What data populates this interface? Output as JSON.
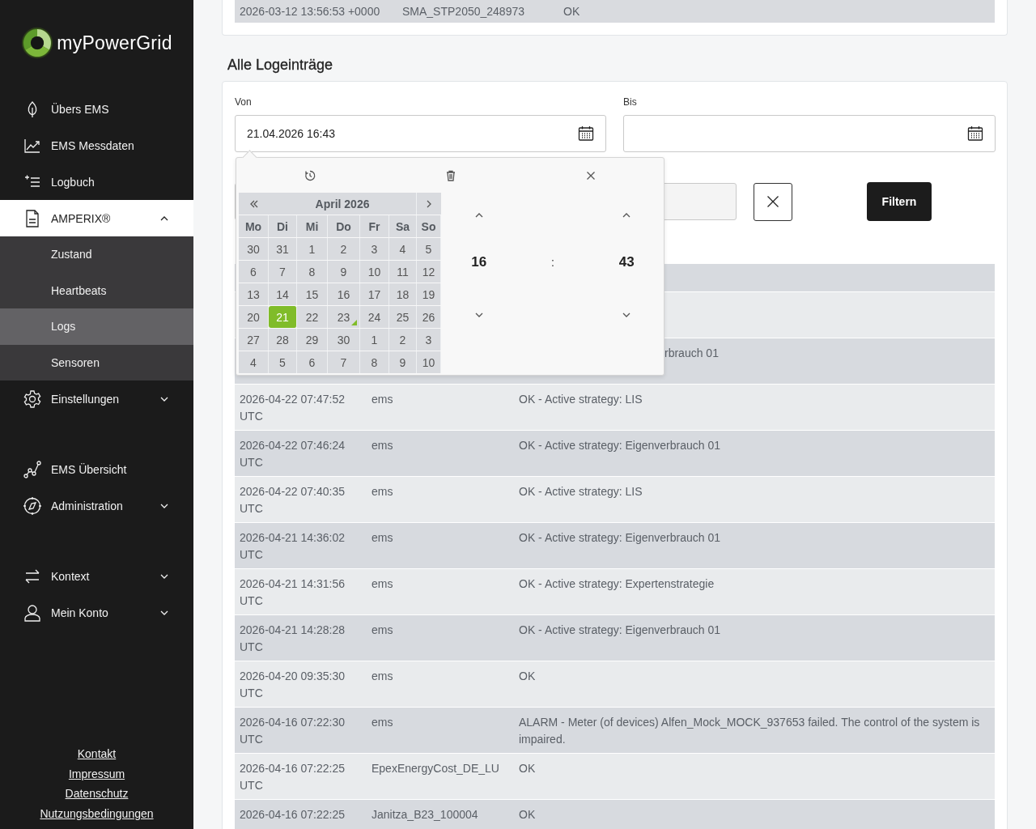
{
  "sidebar": {
    "logo": "myPowerGrid",
    "groups": [
      {
        "items": [
          {
            "label": "Übers EMS",
            "selected": false
          },
          {
            "label": "EMS Messdaten",
            "selected": false
          },
          {
            "label": "Logbuch",
            "selected": false
          },
          {
            "label": "AMPERIX®",
            "selected": false,
            "expanded": true,
            "children": [
              {
                "label": "Zustand",
                "selected": false
              },
              {
                "label": "Heartbeats",
                "selected": false
              },
              {
                "label": "Logs",
                "selected": true
              },
              {
                "label": "Sensoren",
                "selected": false
              }
            ]
          },
          {
            "label": "Einstellungen",
            "selected": false,
            "expanded": false
          }
        ]
      },
      {
        "items": [
          {
            "label": "EMS Übersicht",
            "selected": false
          },
          {
            "label": "Administration",
            "selected": false,
            "expanded": false
          }
        ]
      },
      {
        "items": [
          {
            "label": "Kontext",
            "selected": false,
            "expanded": false
          },
          {
            "label": "Mein Konto",
            "selected": false,
            "expanded": false
          }
        ]
      }
    ],
    "footer_links": [
      "Kontakt",
      "Impressum",
      "Datenschutz",
      "Nutzungsbedingungen"
    ]
  },
  "top_table": {
    "rows": [
      {
        "time": "2026-03-12 13:56:53 +0000",
        "source": "SMA_STP2050_248973",
        "message": "OK"
      }
    ]
  },
  "section_title": "Alle Logeinträge",
  "filter": {
    "from": {
      "label": "Von",
      "value": "21.04.2026 16:43"
    },
    "to": {
      "label": "Bis"
    },
    "filter_button": "Filtern"
  },
  "date_picker": {
    "month": "April 2026",
    "weekdays": [
      "Mo",
      "Di",
      "Mi",
      "Do",
      "Fr",
      "Sa",
      "So"
    ],
    "days": [
      {
        "d": "30",
        "selected": false,
        "today": false
      },
      {
        "d": "31",
        "selected": false,
        "today": false
      },
      {
        "d": "1",
        "selected": false,
        "today": false
      },
      {
        "d": "2",
        "selected": false,
        "today": false
      },
      {
        "d": "3",
        "selected": false,
        "today": false
      },
      {
        "d": "4",
        "selected": false,
        "today": false
      },
      {
        "d": "5",
        "selected": false,
        "today": false
      },
      {
        "d": "6",
        "selected": false,
        "today": false
      },
      {
        "d": "7",
        "selected": false,
        "today": false
      },
      {
        "d": "8",
        "selected": false,
        "today": false
      },
      {
        "d": "9",
        "selected": false,
        "today": false
      },
      {
        "d": "10",
        "selected": false,
        "today": false
      },
      {
        "d": "11",
        "selected": false,
        "today": false
      },
      {
        "d": "12",
        "selected": false,
        "today": false
      },
      {
        "d": "13",
        "selected": false,
        "today": false
      },
      {
        "d": "14",
        "selected": false,
        "today": false
      },
      {
        "d": "15",
        "selected": false,
        "today": false
      },
      {
        "d": "16",
        "selected": false,
        "today": false
      },
      {
        "d": "17",
        "selected": false,
        "today": false
      },
      {
        "d": "18",
        "selected": false,
        "today": false
      },
      {
        "d": "19",
        "selected": false,
        "today": false
      },
      {
        "d": "20",
        "selected": false,
        "today": false
      },
      {
        "d": "21",
        "selected": true,
        "today": false
      },
      {
        "d": "22",
        "selected": false,
        "today": false
      },
      {
        "d": "23",
        "selected": false,
        "today": true
      },
      {
        "d": "24",
        "selected": false,
        "today": false
      },
      {
        "d": "25",
        "selected": false,
        "today": false
      },
      {
        "d": "26",
        "selected": false,
        "today": false
      },
      {
        "d": "27",
        "selected": false,
        "today": false
      },
      {
        "d": "28",
        "selected": false,
        "today": false
      },
      {
        "d": "29",
        "selected": false,
        "today": false
      },
      {
        "d": "30",
        "selected": false,
        "today": false
      },
      {
        "d": "1",
        "selected": false,
        "today": false
      },
      {
        "d": "2",
        "selected": false,
        "today": false
      },
      {
        "d": "3",
        "selected": false,
        "today": false
      },
      {
        "d": "4",
        "selected": false,
        "today": false
      },
      {
        "d": "5",
        "selected": false,
        "today": false
      },
      {
        "d": "6",
        "selected": false,
        "today": false
      },
      {
        "d": "7",
        "selected": false,
        "today": false
      },
      {
        "d": "8",
        "selected": false,
        "today": false
      },
      {
        "d": "9",
        "selected": false,
        "today": false
      },
      {
        "d": "10",
        "selected": false,
        "today": false
      }
    ],
    "hour": "16",
    "separator": ":",
    "minute": "43"
  },
  "log_table": {
    "rows": [
      {
        "kind": "covered"
      },
      {
        "kind": "covered",
        "message": "rbrauch 01"
      },
      {
        "kind": "entry",
        "time": "2026-04-22 07:47:52",
        "zone": "UTC",
        "source": "ems",
        "message": "OK - Active strategy: LIS"
      },
      {
        "kind": "entry",
        "time": "2026-04-22 07:46:24",
        "zone": "UTC",
        "source": "ems",
        "message": "OK - Active strategy: Eigenverbrauch 01"
      },
      {
        "kind": "entry",
        "time": "2026-04-22 07:40:35",
        "zone": "UTC",
        "source": "ems",
        "message": "OK - Active strategy: LIS"
      },
      {
        "kind": "entry",
        "time": "2026-04-21 14:36:02",
        "zone": "UTC",
        "source": "ems",
        "message": "OK - Active strategy: Eigenverbrauch 01"
      },
      {
        "kind": "entry",
        "time": "2026-04-21 14:31:56",
        "zone": "UTC",
        "source": "ems",
        "message": "OK - Active strategy: Expertenstrategie"
      },
      {
        "kind": "entry",
        "time": "2026-04-21 14:28:28",
        "zone": "UTC",
        "source": "ems",
        "message": "OK - Active strategy: Eigenverbrauch 01"
      },
      {
        "kind": "entry",
        "time": "2026-04-20 09:35:30",
        "zone": "UTC",
        "source": "ems",
        "message": "OK"
      },
      {
        "kind": "entry",
        "time": "2026-04-16 07:22:30",
        "zone": "UTC",
        "source": "ems",
        "message": "ALARM - Meter (of devices) Alfen_Mock_MOCK_937653 failed. The control of the system is impaired."
      },
      {
        "kind": "entry",
        "time": "2026-04-16 07:22:25",
        "zone": "UTC",
        "source": "EpexEnergyCost_DE_LU",
        "message": "OK"
      },
      {
        "kind": "entry",
        "time": "2026-04-16 07:22:25",
        "source": "Janitza_B23_100004",
        "message": "OK"
      }
    ]
  }
}
